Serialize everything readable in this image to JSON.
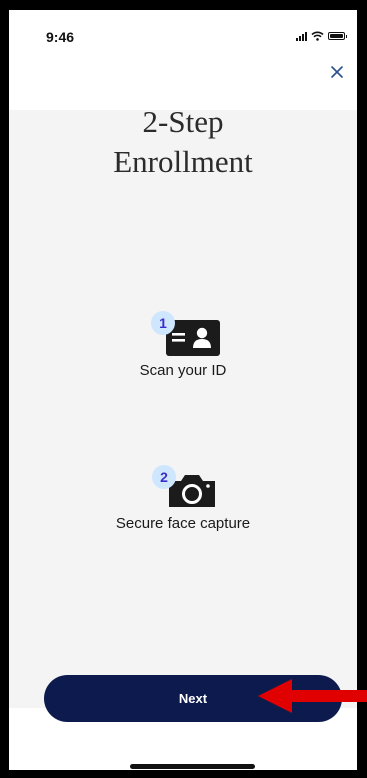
{
  "status_bar": {
    "time": "9:46"
  },
  "header": {
    "title_line1": "2-Step",
    "title_line2": "Enrollment"
  },
  "steps": [
    {
      "number": "1",
      "label": "Scan your ID",
      "icon": "id-card-icon"
    },
    {
      "number": "2",
      "label": "Secure face capture",
      "icon": "camera-icon"
    }
  ],
  "footer": {
    "next_label": "Next"
  },
  "colors": {
    "primary": "#0d1a4d",
    "badge_bg": "#cfe6ff",
    "badge_text": "#3b2fc9",
    "annotation": "#e00000"
  }
}
